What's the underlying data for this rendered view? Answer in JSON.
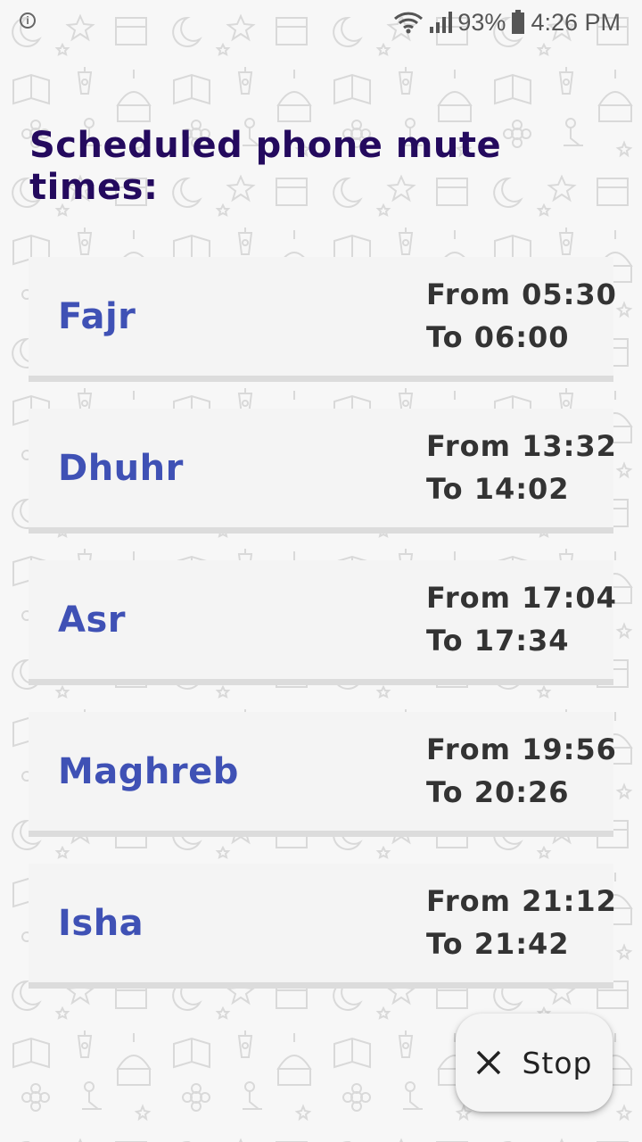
{
  "status_bar": {
    "notification_icon": "info-circle-icon",
    "wifi_icon": "wifi-icon",
    "signal_icon": "cell-signal-icon",
    "battery_percent": "93%",
    "battery_icon": "battery-icon",
    "time": "4:26 PM"
  },
  "title": "Scheduled phone mute times:",
  "prayers": [
    {
      "name": "Fajr",
      "from": "From 05:30",
      "to": "To 06:00"
    },
    {
      "name": "Dhuhr",
      "from": "From 13:32",
      "to": "To 14:02"
    },
    {
      "name": "Asr",
      "from": "From 17:04",
      "to": "To 17:34"
    },
    {
      "name": "Maghreb",
      "from": "From 19:56",
      "to": "To 20:26"
    },
    {
      "name": "Isha",
      "from": "From 21:12",
      "to": "To 21:42"
    }
  ],
  "stop_button": {
    "label": "Stop",
    "icon": "close-icon"
  },
  "colors": {
    "title": "#240a5e",
    "prayer_name": "#3f51b5",
    "time_text": "#333333",
    "card_bg": "#f4f4f4",
    "card_divider": "#dcdcdc"
  }
}
